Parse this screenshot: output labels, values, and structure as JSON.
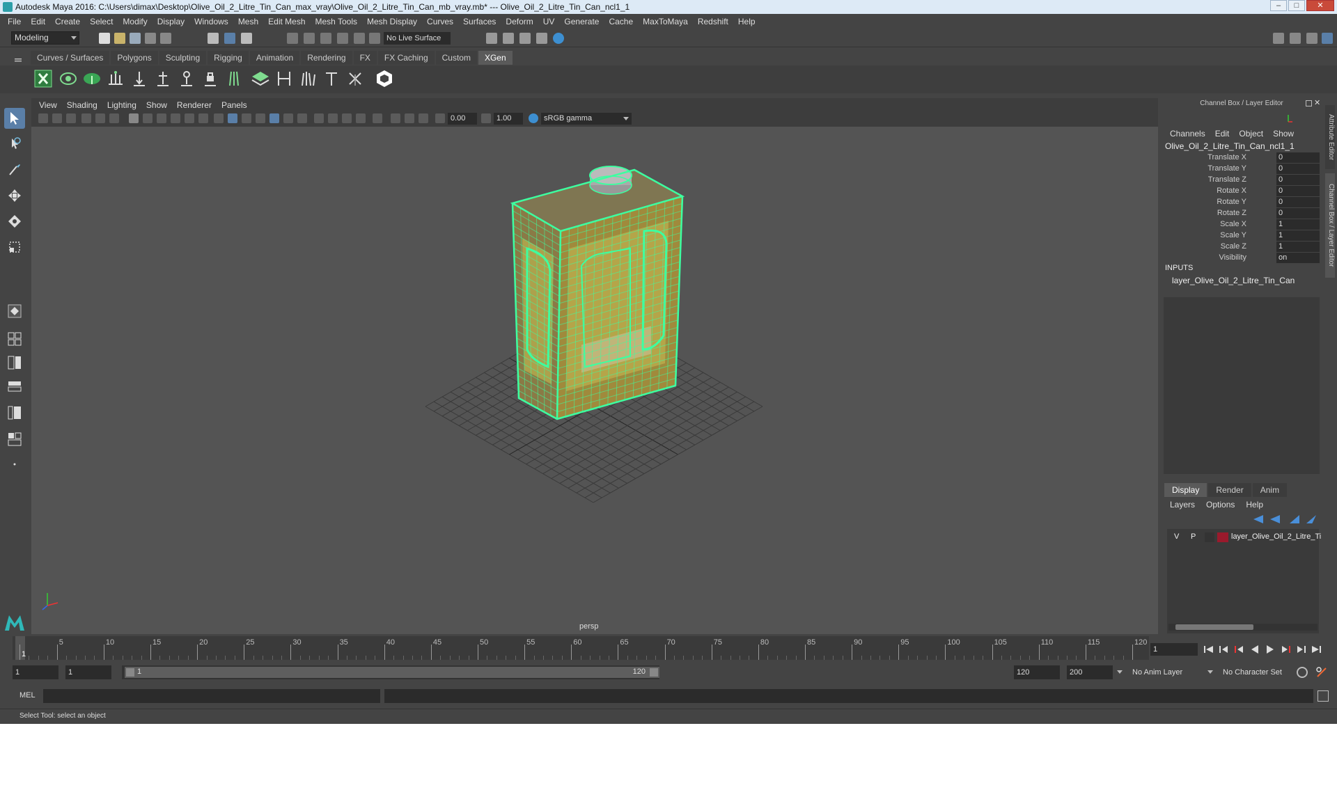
{
  "window": {
    "title": "Autodesk Maya 2016: C:\\Users\\dimax\\Desktop\\Olive_Oil_2_Litre_Tin_Can_max_vray\\Olive_Oil_2_Litre_Tin_Can_mb_vray.mb*  ---  Olive_Oil_2_Litre_Tin_Can_ncl1_1",
    "minimize": "–",
    "maximize": "□",
    "close": "✕"
  },
  "menubar": [
    "File",
    "Edit",
    "Create",
    "Select",
    "Modify",
    "Display",
    "Windows",
    "Mesh",
    "Edit Mesh",
    "Mesh Tools",
    "Mesh Display",
    "Curves",
    "Surfaces",
    "Deform",
    "UV",
    "Generate",
    "Cache",
    "MaxToMaya",
    "Redshift",
    "Help"
  ],
  "statusline": {
    "mode": "Modeling",
    "live_surface": "No Live Surface"
  },
  "shelf": {
    "tabs": [
      "Curves / Surfaces",
      "Polygons",
      "Sculpting",
      "Rigging",
      "Animation",
      "Rendering",
      "FX",
      "FX Caching",
      "Custom",
      "XGen"
    ],
    "active_tab": "XGen"
  },
  "viewport": {
    "menus": [
      "View",
      "Shading",
      "Lighting",
      "Show",
      "Renderer",
      "Panels"
    ],
    "exposure": "0.00",
    "gamma": "1.00",
    "color_space": "sRGB gamma",
    "camera": "persp"
  },
  "channel_box": {
    "header": "Channel Box / Layer Editor",
    "menus": [
      "Channels",
      "Edit",
      "Object",
      "Show"
    ],
    "object_name": "Olive_Oil_2_Litre_Tin_Can_ncl1_1",
    "attributes": [
      {
        "name": "Translate X",
        "value": "0"
      },
      {
        "name": "Translate Y",
        "value": "0"
      },
      {
        "name": "Translate Z",
        "value": "0"
      },
      {
        "name": "Rotate X",
        "value": "0"
      },
      {
        "name": "Rotate Y",
        "value": "0"
      },
      {
        "name": "Rotate Z",
        "value": "0"
      },
      {
        "name": "Scale X",
        "value": "1"
      },
      {
        "name": "Scale Y",
        "value": "1"
      },
      {
        "name": "Scale Z",
        "value": "1"
      },
      {
        "name": "Visibility",
        "value": "on"
      }
    ],
    "inputs_label": "INPUTS",
    "input_layer": "layer_Olive_Oil_2_Litre_Tin_Can",
    "side_tabs": [
      "Attribute Editor",
      "Channel Box / Layer Editor"
    ]
  },
  "layer_editor": {
    "tabs": [
      "Display",
      "Render",
      "Anim"
    ],
    "active_tab": "Display",
    "menus": [
      "Layers",
      "Options",
      "Help"
    ],
    "layers": [
      {
        "visible": "V",
        "playback": "P",
        "name": "layer_Olive_Oil_2_Litre_Ti",
        "color": "#9a1a2c"
      }
    ]
  },
  "timeline": {
    "ticks": [
      "1",
      "5",
      "10",
      "15",
      "20",
      "25",
      "30",
      "35",
      "40",
      "45",
      "50",
      "55",
      "60",
      "65",
      "70",
      "75",
      "80",
      "85",
      "90",
      "95",
      "100",
      "105",
      "110",
      "115",
      "120"
    ],
    "current_frame": "1"
  },
  "range": {
    "start": "1",
    "playback_start": "1",
    "slider_start": "1",
    "slider_end": "120",
    "playback_end": "120",
    "end": "200",
    "anim_layer": "No Anim Layer",
    "character_set": "No Character Set"
  },
  "command": {
    "language": "MEL",
    "help_text": "Select Tool: select an object"
  },
  "colors": {
    "wireframe": "#3dffa0",
    "accent_blue": "#5a7fa8",
    "xgen_green": "#3aa655"
  }
}
